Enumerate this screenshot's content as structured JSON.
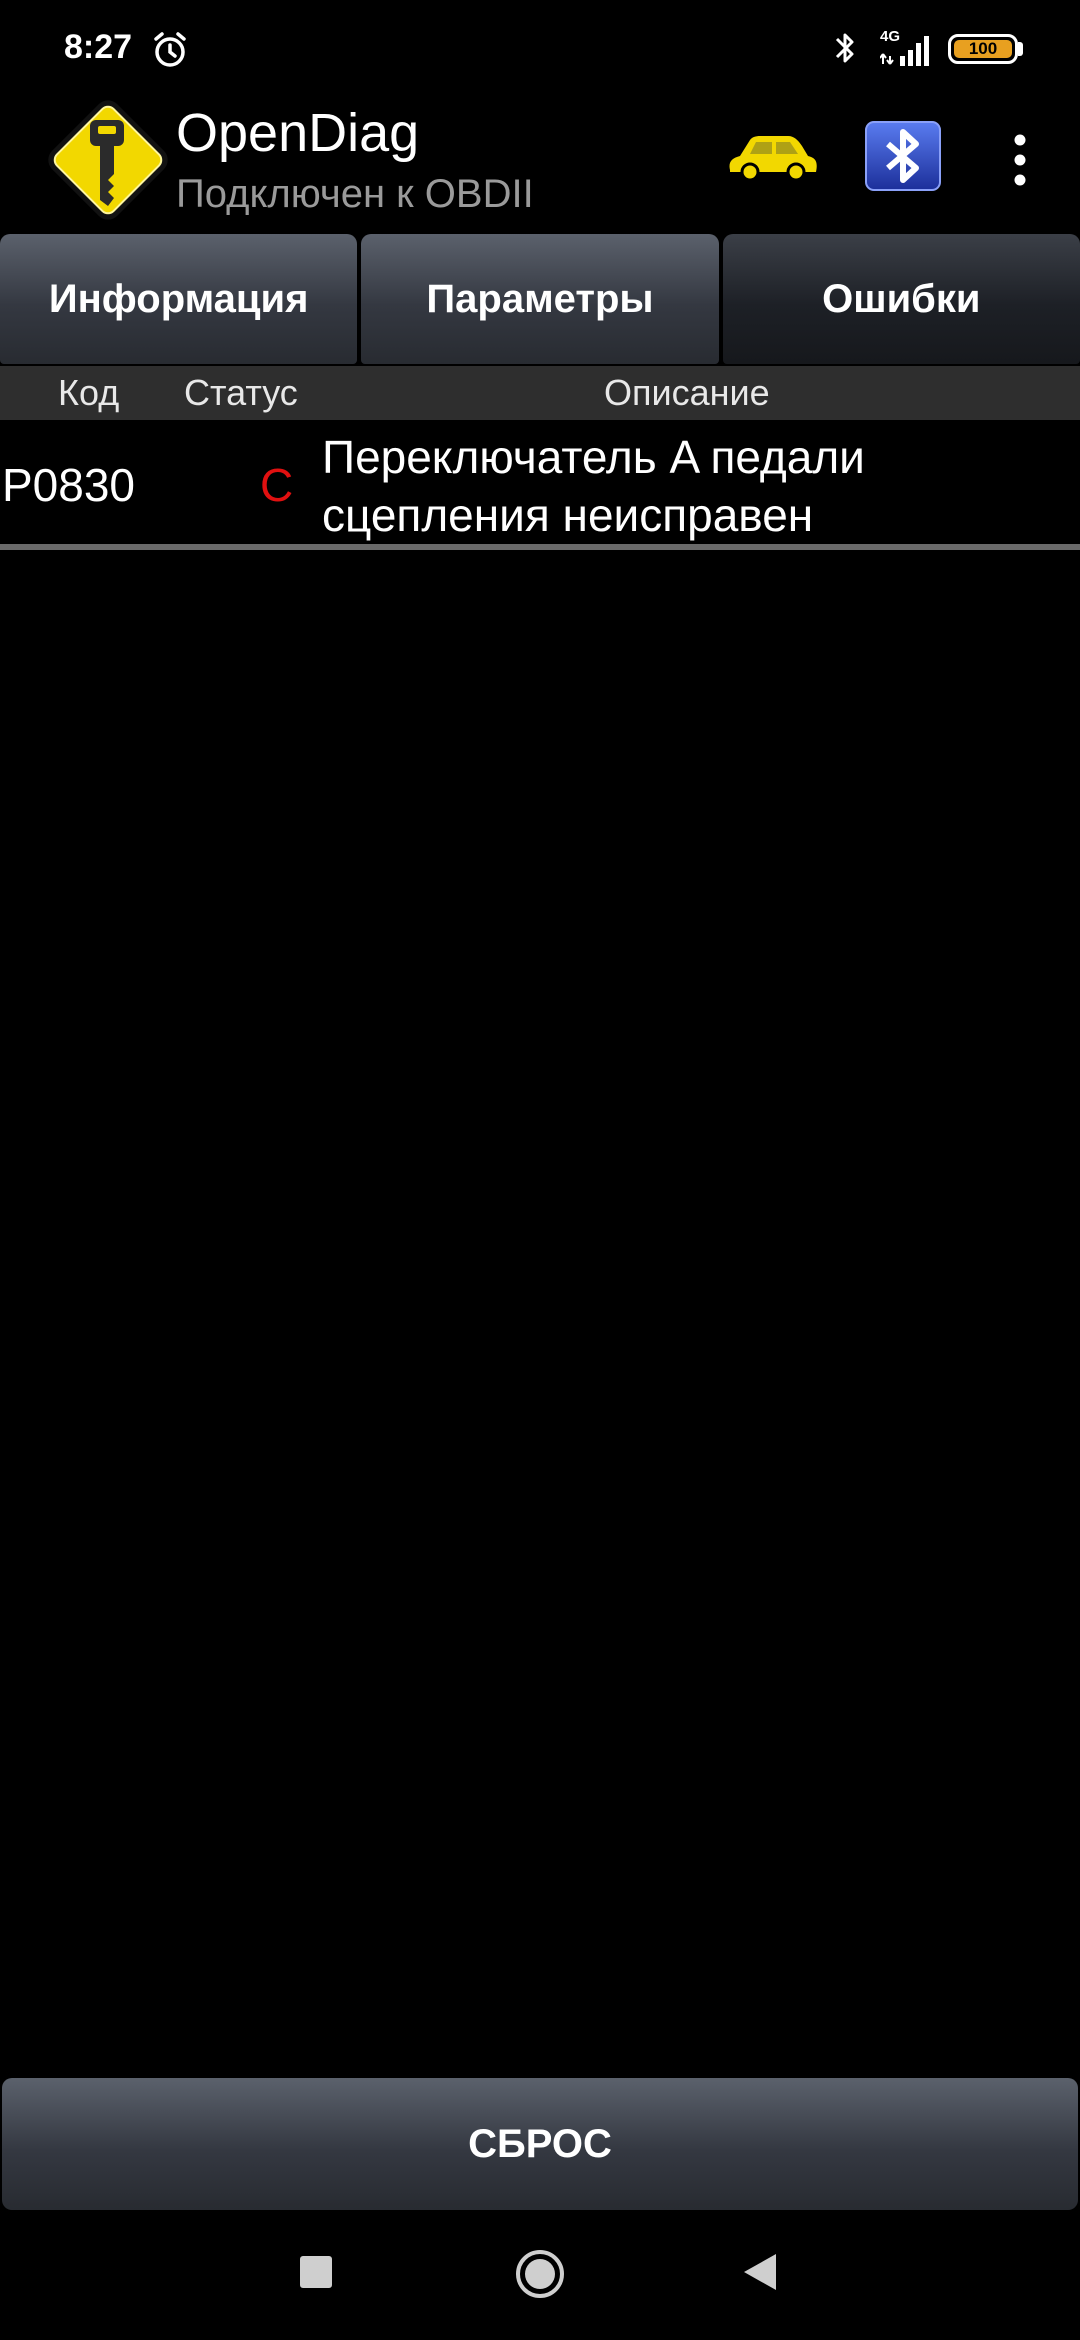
{
  "status_bar": {
    "time": "8:27",
    "network": "4G",
    "battery": "100",
    "icons": [
      "alarm-icon",
      "bluetooth-icon",
      "signal-icon",
      "battery-icon"
    ]
  },
  "app_bar": {
    "title": "OpenDiag",
    "subtitle": "Подключен к OBDII",
    "icons": [
      "app-logo-key-icon",
      "car-icon",
      "bluetooth-adapter-icon",
      "overflow-menu-icon"
    ]
  },
  "tabs": [
    {
      "label": "Информация",
      "active": false
    },
    {
      "label": "Параметры",
      "active": false
    },
    {
      "label": "Ошибки",
      "active": true
    }
  ],
  "table": {
    "headers": {
      "code": "Код",
      "status": "Статус",
      "description": "Описание"
    },
    "rows": [
      {
        "code": "P0830",
        "status": "C",
        "description": "Переключатель A педали сцепления неисправен"
      }
    ]
  },
  "reset_label": "СБРОС",
  "colors": {
    "background": "#000000",
    "status_error": "#e01010",
    "logo_yellow": "#f2d800",
    "battery": "#e8a020",
    "bt_blue": "#2846c8"
  },
  "nav_bar": {
    "icons": [
      "recents-square-icon",
      "home-circle-icon",
      "back-triangle-icon"
    ]
  }
}
